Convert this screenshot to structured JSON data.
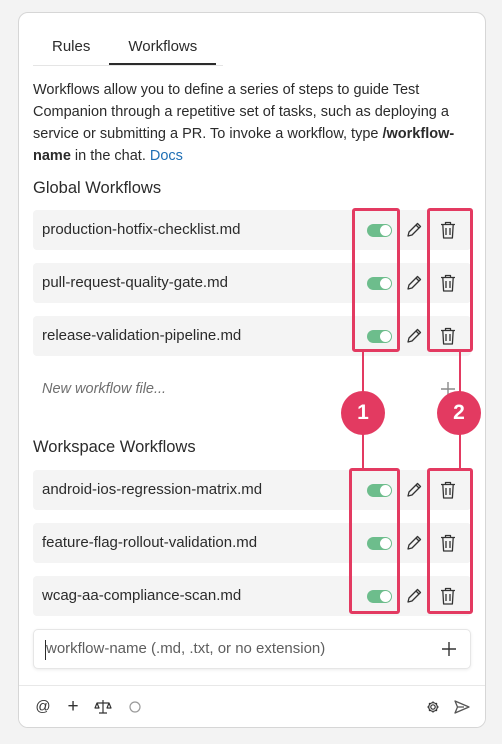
{
  "tabs": [
    {
      "label": "Rules",
      "active": false
    },
    {
      "label": "Workflows",
      "active": true
    }
  ],
  "description": {
    "text": "Workflows allow you to define a series of steps to guide Test Companion through a repetitive set of tasks, such as deploying a service or submitting a PR. To invoke a workflow, type ",
    "command": "/workflow-name",
    "suffix": " in the chat. ",
    "docs_link": "Docs"
  },
  "global_section": {
    "title": "Global Workflows",
    "items": [
      {
        "name": "production-hotfix-checklist.md",
        "enabled": true
      },
      {
        "name": "pull-request-quality-gate.md",
        "enabled": true
      },
      {
        "name": "release-validation-pipeline.md",
        "enabled": true
      }
    ],
    "new_file_placeholder": "New workflow file..."
  },
  "workspace_section": {
    "title": "Workspace Workflows",
    "items": [
      {
        "name": "android-ios-regression-matrix.md",
        "enabled": true
      },
      {
        "name": "feature-flag-rollout-validation.md",
        "enabled": true
      },
      {
        "name": "wcag-aa-compliance-scan.md",
        "enabled": true
      }
    ]
  },
  "workflow_input": {
    "placeholder": "workflow-name (.md, .txt, or no extension)"
  },
  "bottom_bar": {
    "at_label": "@",
    "plus_label": "+"
  },
  "annotations": {
    "badge_1": "1",
    "badge_2": "2",
    "color": "#e33a61"
  },
  "colors": {
    "toggle_on": "#6dbd8c",
    "link": "#1f6fb4"
  }
}
